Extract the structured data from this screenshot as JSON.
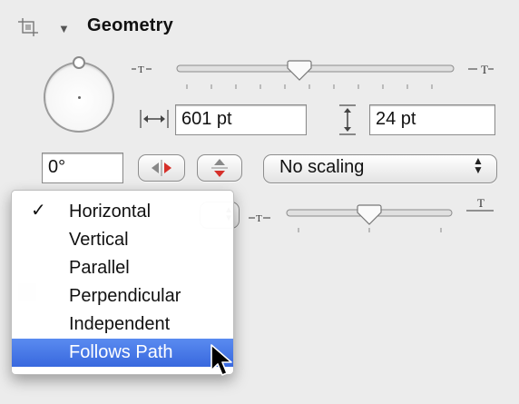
{
  "section": {
    "title": "Geometry",
    "icon": "geometry-icon",
    "disclosure_icon": "disclosure-triangle-down-icon"
  },
  "size": {
    "small_label": "T",
    "large_label": "T",
    "width_value": "601 pt",
    "height_value": "24 pt",
    "width_icon": "horizontal-resize-icon",
    "height_icon": "vertical-resize-icon"
  },
  "rotation": {
    "angle_value": "0°",
    "knob_icon": "rotation-knob"
  },
  "flip": {
    "horizontal_icon": "flip-horizontal-icon",
    "vertical_icon": "flip-vertical-icon"
  },
  "scaling": {
    "selected": "No scaling",
    "icon": "popup-arrows-icon"
  },
  "path_size": {
    "small_label": "T",
    "large_label": "T"
  },
  "menu": {
    "check": "✓",
    "items": [
      {
        "label": "Horizontal",
        "checked": true
      },
      {
        "label": "Vertical"
      },
      {
        "label": "Parallel"
      },
      {
        "label": "Perpendicular"
      },
      {
        "label": "Independent"
      },
      {
        "label": "Follows Path",
        "highlighted": true
      }
    ]
  },
  "colors": {
    "highlight": "#3c6edf",
    "panel_bg": "#ececec"
  }
}
